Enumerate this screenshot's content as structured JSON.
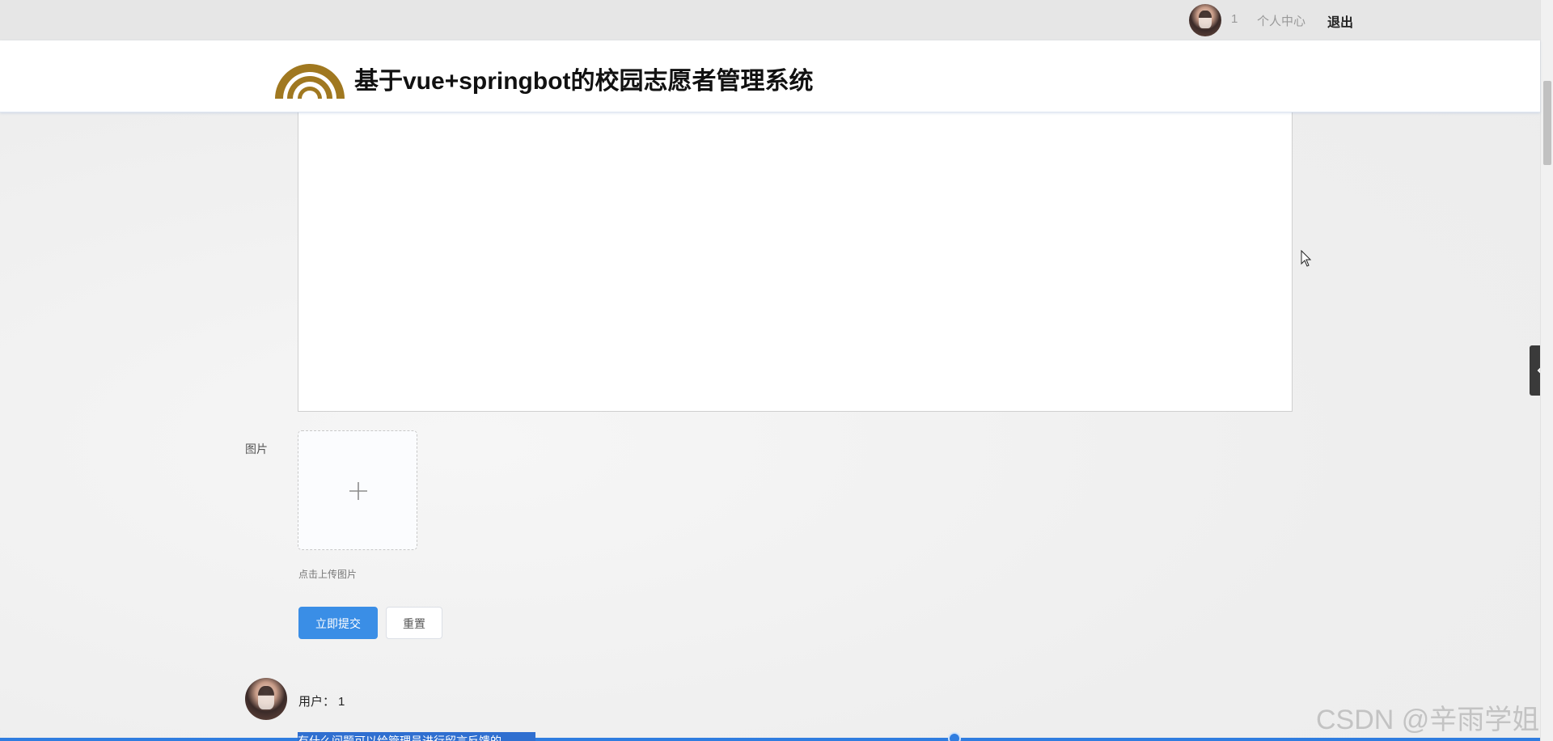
{
  "topbar": {
    "user_number": "1",
    "personal_center": "个人中心",
    "logout": "退出"
  },
  "header": {
    "title": "基于vue+springbot的校园志愿者管理系统",
    "logo_color": "#a07820"
  },
  "form": {
    "image_label": "图片",
    "upload_tip": "点击上传图片",
    "submit_label": "立即提交",
    "reset_label": "重置"
  },
  "comment": {
    "user_label": "用户：",
    "user_value": "1",
    "highlighted_text": "有什么问题可以给管理员进行留言反馈的"
  },
  "watermark": "CSDN @辛雨学姐",
  "colors": {
    "primary": "#3a8ee6",
    "selection": "#2f6fd0"
  }
}
